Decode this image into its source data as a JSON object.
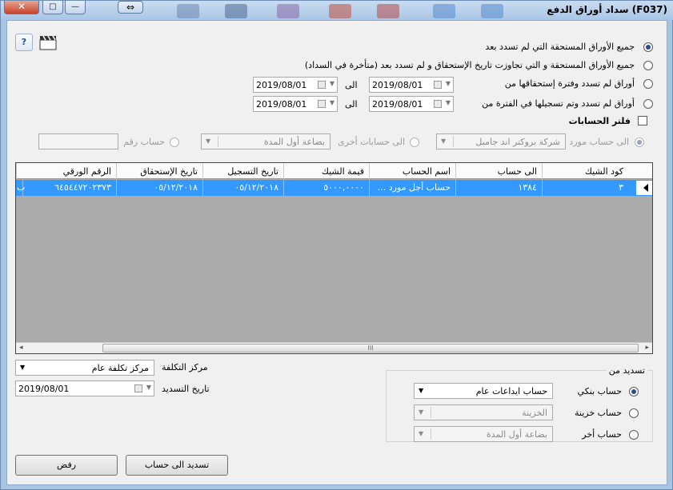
{
  "window": {
    "title": "سداد أوراق الدفع",
    "form_code": "(F037)",
    "close_glyph": "✕",
    "maximize_glyph": "□",
    "minimize_glyph": "—",
    "move_glyph": "⇔"
  },
  "toolbar": {
    "help_glyph": "?",
    "help_icon": "help-icon",
    "clapper_icon": "clapperboard-icon"
  },
  "filters": {
    "option1": "جميع الأوراق المستحقة التي لم تسدد بعد",
    "option2": "جميع الأوراق المستحقة و التي تجاوزت تاريخ الإستحقاق و لم تسدد بعد (متأخرة في السداد)",
    "option3": "أوراق لم تسدد وفترة إستحقاقها من",
    "option4": "أوراق لم تسدد وتم تسجيلها في الفترة من",
    "to_label": "الى",
    "due_from": "2019/08/01",
    "due_to": "2019/08/01",
    "reg_from": "2019/08/01",
    "reg_to": "2019/08/01",
    "selected": 1
  },
  "account_filter": {
    "checkbox_label": "فلتر الحسابات",
    "to_supplier_label": "الى حساب مورد",
    "supplier_value": "شركة بروكتر اند جامبل",
    "to_other_label": "الى حسابات أخرى",
    "other_value": "بضاعة أول المدة",
    "account_no_label": "حساب رقم",
    "account_no_value": ""
  },
  "grid": {
    "columns": [
      "كود الشيك",
      "الى حساب",
      "اسم الحساب",
      "قيمة الشيك",
      "تاريخ التسجيل",
      "تاريخ الإستحقاق",
      "الرقم الورقي"
    ],
    "rows": [
      [
        "٣",
        "١٣٨٤",
        "حساب أجل مورد ...",
        "٥٠٠٠,٠٠٠٠",
        "٠٥/١٢/٢٠١٨",
        "٠٥/١٢/٢٠١٨",
        "٦٤٥٤٤٧٢٠٢٣٧٣"
      ]
    ],
    "row_edge_char": "ب",
    "scroll_grip": "III",
    "scroll_left": "◂",
    "scroll_right": "▸"
  },
  "cost_center": {
    "label": "مركز التكلفة",
    "value": "مركز تكلفة عام"
  },
  "payment_date": {
    "label": "تاريخ التسديد",
    "value": "2019/08/01"
  },
  "pay_from": {
    "title": "تسديد من",
    "bank_label": "حساب بنكي",
    "bank_value": "حساب ايداعات عام",
    "treasury_label": "حساب خزينة",
    "treasury_value": "الخزينة",
    "other_label": "حساب أخر",
    "other_value": "بضاعة أول المدة",
    "selected": "bank"
  },
  "buttons": {
    "pay_to_account": "تسديد الى حساب",
    "reject": "رفض"
  },
  "colors": {
    "selection": "#3399ff",
    "window_frame": "#a7c4e3",
    "close_button": "#c7432b"
  }
}
